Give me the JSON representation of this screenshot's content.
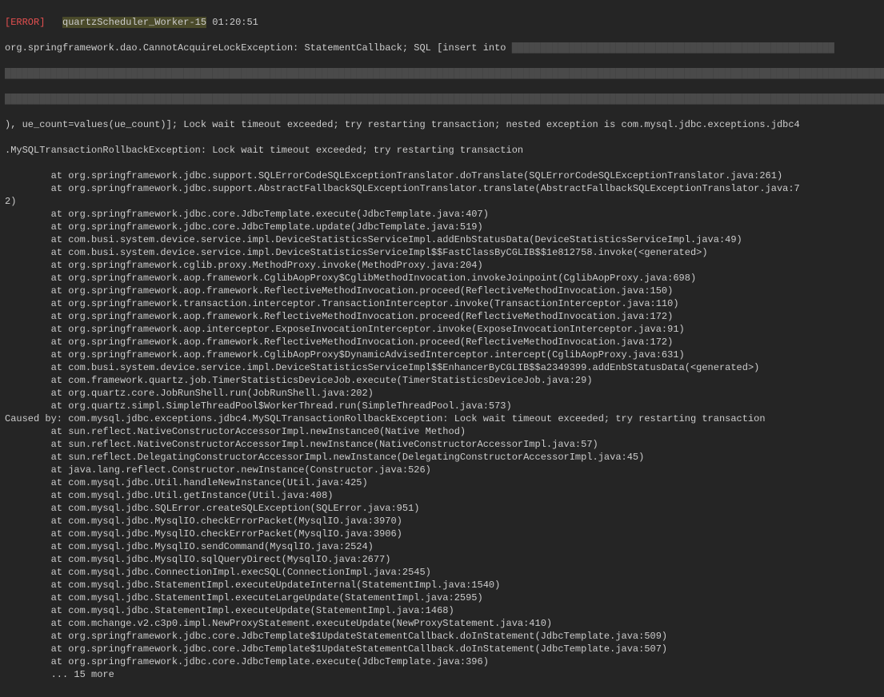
{
  "header": {
    "label": "[ERROR]",
    "thread": "quartzScheduler_Worker-15",
    "time": "01:20:51"
  },
  "sql_prefix": "org.springframework.dao.CannotAcquireLockException: StatementCallback; SQL [insert into ",
  "obf1": "████████████████████████████████████████████████████████",
  "obf2": "██████████████████████████████████████████████████████████████████████████████████████████████████████████████████████████████████████████████████████████████████████████████████████████████████████████████████████████████████████████████████████████████████████████████████████████████",
  "obf3": "████████████████████████████████████████████████████████████████████████████████████████████████████████████████████████████████████████████████████████████████████████████████████████████████████████████████████████████████████████████████████████████████████████████████████████████████",
  "sql_tail": "), ue_count=values(ue_count)]; Lock wait timeout exceeded; try restarting transaction; nested exception is com.mysql.jdbc.exceptions.jdbc4",
  "rollback": ".MySQLTransactionRollbackException: Lock wait timeout exceeded; try restarting transaction",
  "stack": [
    "        at org.springframework.jdbc.support.SQLErrorCodeSQLExceptionTranslator.doTranslate(SQLErrorCodeSQLExceptionTranslator.java:261)",
    "        at org.springframework.jdbc.support.AbstractFallbackSQLExceptionTranslator.translate(AbstractFallbackSQLExceptionTranslator.java:7",
    "2)",
    "        at org.springframework.jdbc.core.JdbcTemplate.execute(JdbcTemplate.java:407)",
    "        at org.springframework.jdbc.core.JdbcTemplate.update(JdbcTemplate.java:519)",
    "        at com.busi.system.device.service.impl.DeviceStatisticsServiceImpl.addEnbStatusData(DeviceStatisticsServiceImpl.java:49)",
    "        at com.busi.system.device.service.impl.DeviceStatisticsServiceImpl$$FastClassByCGLIB$$1e812758.invoke(<generated>)",
    "        at org.springframework.cglib.proxy.MethodProxy.invoke(MethodProxy.java:204)",
    "        at org.springframework.aop.framework.CglibAopProxy$CglibMethodInvocation.invokeJoinpoint(CglibAopProxy.java:698)",
    "        at org.springframework.aop.framework.ReflectiveMethodInvocation.proceed(ReflectiveMethodInvocation.java:150)",
    "        at org.springframework.transaction.interceptor.TransactionInterceptor.invoke(TransactionInterceptor.java:110)",
    "        at org.springframework.aop.framework.ReflectiveMethodInvocation.proceed(ReflectiveMethodInvocation.java:172)",
    "        at org.springframework.aop.interceptor.ExposeInvocationInterceptor.invoke(ExposeInvocationInterceptor.java:91)",
    "        at org.springframework.aop.framework.ReflectiveMethodInvocation.proceed(ReflectiveMethodInvocation.java:172)",
    "        at org.springframework.aop.framework.CglibAopProxy$DynamicAdvisedInterceptor.intercept(CglibAopProxy.java:631)",
    "        at com.busi.system.device.service.impl.DeviceStatisticsServiceImpl$$EnhancerByCGLIB$$a2349399.addEnbStatusData(<generated>)",
    "        at com.framework.quartz.job.TimerStatisticsDeviceJob.execute(TimerStatisticsDeviceJob.java:29)",
    "        at org.quartz.core.JobRunShell.run(JobRunShell.java:202)",
    "        at org.quartz.simpl.SimpleThreadPool$WorkerThread.run(SimpleThreadPool.java:573)",
    "Caused by: com.mysql.jdbc.exceptions.jdbc4.MySQLTransactionRollbackException: Lock wait timeout exceeded; try restarting transaction",
    "        at sun.reflect.NativeConstructorAccessorImpl.newInstance0(Native Method)",
    "        at sun.reflect.NativeConstructorAccessorImpl.newInstance(NativeConstructorAccessorImpl.java:57)",
    "        at sun.reflect.DelegatingConstructorAccessorImpl.newInstance(DelegatingConstructorAccessorImpl.java:45)",
    "        at java.lang.reflect.Constructor.newInstance(Constructor.java:526)",
    "        at com.mysql.jdbc.Util.handleNewInstance(Util.java:425)",
    "        at com.mysql.jdbc.Util.getInstance(Util.java:408)",
    "        at com.mysql.jdbc.SQLError.createSQLException(SQLError.java:951)",
    "        at com.mysql.jdbc.MysqlIO.checkErrorPacket(MysqlIO.java:3970)",
    "        at com.mysql.jdbc.MysqlIO.checkErrorPacket(MysqlIO.java:3906)",
    "        at com.mysql.jdbc.MysqlIO.sendCommand(MysqlIO.java:2524)",
    "        at com.mysql.jdbc.MysqlIO.sqlQueryDirect(MysqlIO.java:2677)",
    "        at com.mysql.jdbc.ConnectionImpl.execSQL(ConnectionImpl.java:2545)",
    "        at com.mysql.jdbc.StatementImpl.executeUpdateInternal(StatementImpl.java:1540)",
    "        at com.mysql.jdbc.StatementImpl.executeLargeUpdate(StatementImpl.java:2595)",
    "        at com.mysql.jdbc.StatementImpl.executeUpdate(StatementImpl.java:1468)",
    "        at com.mchange.v2.c3p0.impl.NewProxyStatement.executeUpdate(NewProxyStatement.java:410)",
    "        at org.springframework.jdbc.core.JdbcTemplate$1UpdateStatementCallback.doInStatement(JdbcTemplate.java:509)",
    "        at org.springframework.jdbc.core.JdbcTemplate$1UpdateStatementCallback.doInStatement(JdbcTemplate.java:507)",
    "        at org.springframework.jdbc.core.JdbcTemplate.execute(JdbcTemplate.java:396)",
    "        ... 15 more"
  ]
}
